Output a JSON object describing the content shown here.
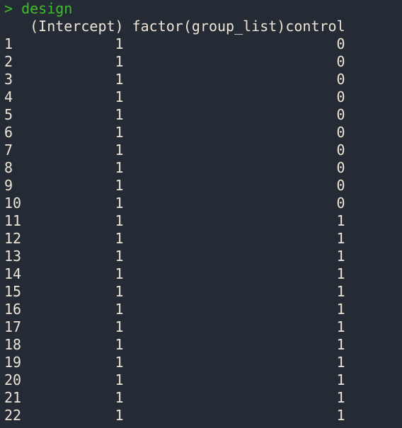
{
  "command": {
    "prompt": ">",
    "text": "design"
  },
  "columns": [
    "(Intercept)",
    "factor(group_list)control"
  ],
  "rows": [
    {
      "label": "1",
      "intercept": "1",
      "control": "0"
    },
    {
      "label": "2",
      "intercept": "1",
      "control": "0"
    },
    {
      "label": "3",
      "intercept": "1",
      "control": "0"
    },
    {
      "label": "4",
      "intercept": "1",
      "control": "0"
    },
    {
      "label": "5",
      "intercept": "1",
      "control": "0"
    },
    {
      "label": "6",
      "intercept": "1",
      "control": "0"
    },
    {
      "label": "7",
      "intercept": "1",
      "control": "0"
    },
    {
      "label": "8",
      "intercept": "1",
      "control": "0"
    },
    {
      "label": "9",
      "intercept": "1",
      "control": "0"
    },
    {
      "label": "10",
      "intercept": "1",
      "control": "0"
    },
    {
      "label": "11",
      "intercept": "1",
      "control": "1"
    },
    {
      "label": "12",
      "intercept": "1",
      "control": "1"
    },
    {
      "label": "13",
      "intercept": "1",
      "control": "1"
    },
    {
      "label": "14",
      "intercept": "1",
      "control": "1"
    },
    {
      "label": "15",
      "intercept": "1",
      "control": "1"
    },
    {
      "label": "16",
      "intercept": "1",
      "control": "1"
    },
    {
      "label": "17",
      "intercept": "1",
      "control": "1"
    },
    {
      "label": "18",
      "intercept": "1",
      "control": "1"
    },
    {
      "label": "19",
      "intercept": "1",
      "control": "1"
    },
    {
      "label": "20",
      "intercept": "1",
      "control": "1"
    },
    {
      "label": "21",
      "intercept": "1",
      "control": "1"
    },
    {
      "label": "22",
      "intercept": "1",
      "control": "1"
    }
  ],
  "colors": {
    "background": "#252b34",
    "prompt": "#3fbf2c",
    "output": "#ece4d6"
  }
}
